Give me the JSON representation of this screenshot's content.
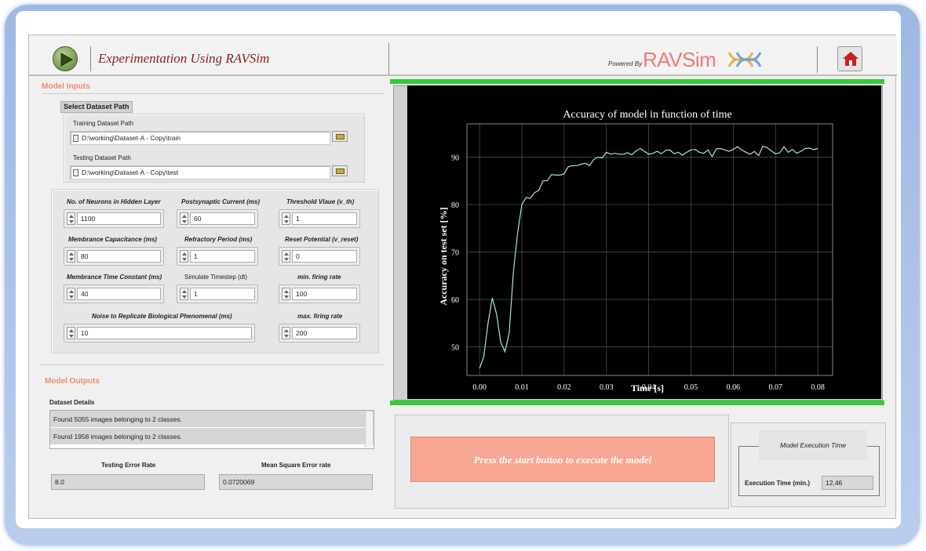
{
  "header": {
    "app_title": "Experimentation Using RAVSim",
    "powered_by": "Powered By",
    "brand": "RAVSim",
    "icons": {
      "play": "play-icon",
      "home": "home-icon",
      "brand_logo": "dna-logo"
    }
  },
  "model_inputs": {
    "title": "Model Inputs",
    "select_dataset_label": "Select Dataset Path",
    "training": {
      "label": "Training Dataset Path",
      "value": "D:\\working\\Dataset-A - Copy\\train"
    },
    "testing": {
      "label": "Testing Dataset Path",
      "value": "D:\\working\\Dataset-A - Copy\\test"
    },
    "params": {
      "neurons": {
        "label": "No. of Neurons in Hidden Layer",
        "value": "1100"
      },
      "psc": {
        "label": "Postsynaptic Current (ms)",
        "value": "60"
      },
      "threshold": {
        "label": "Threshold Vlaue (v_th)",
        "value": "1"
      },
      "capacitance": {
        "label": "Membrance Capacitance (ms)",
        "value": "80"
      },
      "refractory": {
        "label": "Refractory Period (ms)",
        "value": "1"
      },
      "reset": {
        "label": "Reset Potential (v_reset)",
        "value": "0"
      },
      "time_constant": {
        "label": "Membrance Time Constant (ms)",
        "value": "40"
      },
      "timestep": {
        "label": "Simulate Timestep (dt)",
        "value": "1"
      },
      "min_rate": {
        "label": "min. firing rate",
        "value": "100"
      },
      "noise": {
        "label": "Noise to Replicate Biological Phenomenal (ms)",
        "value": "10"
      },
      "max_rate": {
        "label": "max. firing rate",
        "value": "200"
      }
    }
  },
  "model_outputs": {
    "title": "Model Outputs",
    "dataset_details_label": "Dataset Details",
    "details": [
      "Found 5055 images belonging to 2 classes.",
      "Found 1958 images belonging to 2 classes."
    ],
    "testing_error": {
      "label": "Testing Error Rate",
      "value": "8.0"
    },
    "mse": {
      "label": "Mean Square Error rate",
      "value": "0.0720069"
    }
  },
  "start_message": "Press the start button to execute the model",
  "execution": {
    "title": "Model Execution Time",
    "label": "Execution Time (min.)",
    "value": "12.46"
  },
  "colors": {
    "accent_label": "#ee8a72",
    "start_button": "#f6a692",
    "green_bar": "#33cc33",
    "plot_line": "#a8e6cf",
    "plot_bg": "#000000"
  },
  "chart_data": {
    "type": "line",
    "title": "Accuracy of model in function of time",
    "xlabel": "Time [s]",
    "ylabel": "Accuracy on test set [%]",
    "xlim": [
      -0.003,
      0.0835
    ],
    "ylim": [
      44,
      97
    ],
    "xticks": [
      0.0,
      0.01,
      0.02,
      0.03,
      0.04,
      0.05,
      0.06,
      0.07,
      0.08
    ],
    "xtick_labels": [
      "0.00",
      "0.01",
      "0.02",
      "0.03",
      "0.04",
      "0.05",
      "0.06",
      "0.07",
      "0.08"
    ],
    "yticks": [
      50,
      60,
      70,
      80,
      90
    ],
    "ytick_labels": [
      "50",
      "60",
      "70",
      "80",
      "90"
    ],
    "grid": true,
    "series": [
      {
        "x": [
          0.0,
          0.001,
          0.002,
          0.003,
          0.004,
          0.005,
          0.006,
          0.007,
          0.008,
          0.009,
          0.01,
          0.011,
          0.012,
          0.013,
          0.014,
          0.015,
          0.016,
          0.017,
          0.018,
          0.019,
          0.02,
          0.021,
          0.022,
          0.023,
          0.024,
          0.025,
          0.026,
          0.027,
          0.028,
          0.029,
          0.03,
          0.031,
          0.032,
          0.033,
          0.034,
          0.035,
          0.036,
          0.037,
          0.038,
          0.039,
          0.04,
          0.041,
          0.042,
          0.043,
          0.044,
          0.045,
          0.046,
          0.047,
          0.048,
          0.049,
          0.05,
          0.051,
          0.052,
          0.053,
          0.054,
          0.055,
          0.056,
          0.057,
          0.058,
          0.059,
          0.06,
          0.061,
          0.062,
          0.063,
          0.064,
          0.065,
          0.066,
          0.067,
          0.068,
          0.069,
          0.07,
          0.071,
          0.072,
          0.073,
          0.074,
          0.075,
          0.076,
          0.077,
          0.078,
          0.079,
          0.08
        ],
        "y": [
          45.5,
          48,
          55,
          60.3,
          57,
          51,
          49,
          53,
          66,
          74,
          80,
          81.5,
          81.3,
          82.5,
          83,
          85,
          85,
          86.3,
          86.2,
          86.2,
          86.5,
          88,
          88.2,
          88.2,
          88.5,
          88.7,
          88.2,
          89.5,
          90,
          89.8,
          91,
          90.6,
          90.8,
          90.6,
          90.6,
          90.9,
          90.5,
          91.3,
          91.8,
          91.2,
          90.6,
          90.8,
          91.2,
          90.7,
          91.4,
          91.5,
          90.7,
          91.0,
          90.4,
          91.0,
          91.5,
          91.6,
          91.0,
          90.8,
          91.5,
          90.1,
          91.7,
          91.8,
          91.5,
          91.2,
          91.6,
          92.2,
          91.5,
          91.0,
          90.6,
          91.2,
          90.3,
          92.3,
          92.0,
          91.3,
          90.7,
          90.9,
          92.2,
          91.0,
          91.6,
          90.8,
          91.2,
          91.8,
          91.9,
          91.6,
          91.8
        ]
      }
    ]
  }
}
